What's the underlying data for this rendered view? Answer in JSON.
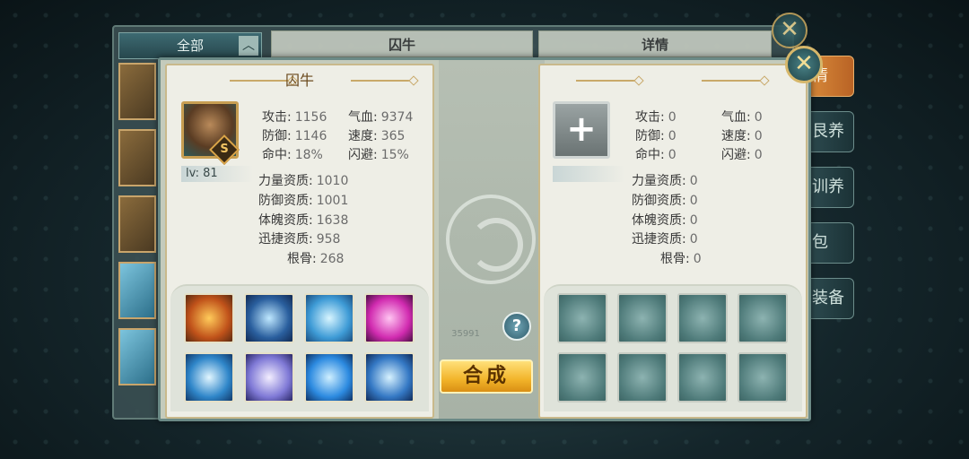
{
  "background_window": {
    "filter_label": "全部",
    "tab_name": "囚牛",
    "tab_details": "详情",
    "side_tabs": [
      "情",
      "艮养",
      "训养",
      "包",
      "装备"
    ]
  },
  "dialog": {
    "merge_label": "合成",
    "help_label": "?",
    "faded_number": "35991",
    "left": {
      "title": "囚牛",
      "grade": "S",
      "level": "lv: 81",
      "stats": {
        "attack_label": "攻击:",
        "attack": "1156",
        "hp_label": "气血:",
        "hp": "9374",
        "defense_label": "防御:",
        "defense": "1146",
        "speed_label": "速度:",
        "speed": "365",
        "hit_label": "命中:",
        "hit": "18%",
        "dodge_label": "闪避:",
        "dodge": "15%"
      },
      "aptitudes": {
        "power_label": "力量资质:",
        "power": "1010",
        "defense_apt_label": "防御资质:",
        "defense_apt": "1001",
        "physique_label": "体魄资质:",
        "physique": "1638",
        "agility_label": "迅捷资质:",
        "agility": "958",
        "root_label": "根骨:",
        "root": "268"
      },
      "skill_icons": [
        "fire-ring-icon",
        "ice-shards-icon",
        "crystal-icon",
        "heart-pink-icon",
        "lightning-icon",
        "orb-icon",
        "blue-heart-icon",
        "crossed-swords-icon"
      ]
    },
    "right": {
      "add_label": "+",
      "stats": {
        "attack_label": "攻击:",
        "attack": "0",
        "hp_label": "气血:",
        "hp": "0",
        "defense_label": "防御:",
        "defense": "0",
        "speed_label": "速度:",
        "speed": "0",
        "hit_label": "命中:",
        "hit": "0",
        "dodge_label": "闪避:",
        "dodge": "0"
      },
      "aptitudes": {
        "power_label": "力量资质:",
        "power": "0",
        "defense_apt_label": "防御资质:",
        "defense_apt": "0",
        "physique_label": "体魄资质:",
        "physique": "0",
        "agility_label": "迅捷资质:",
        "agility": "0",
        "root_label": "根骨:",
        "root": "0"
      }
    }
  },
  "close_label": "✕",
  "colors": {
    "accent_gold": "#f2b42a",
    "panel_bg": "#eeeee6",
    "frame": "#6b8a86"
  }
}
